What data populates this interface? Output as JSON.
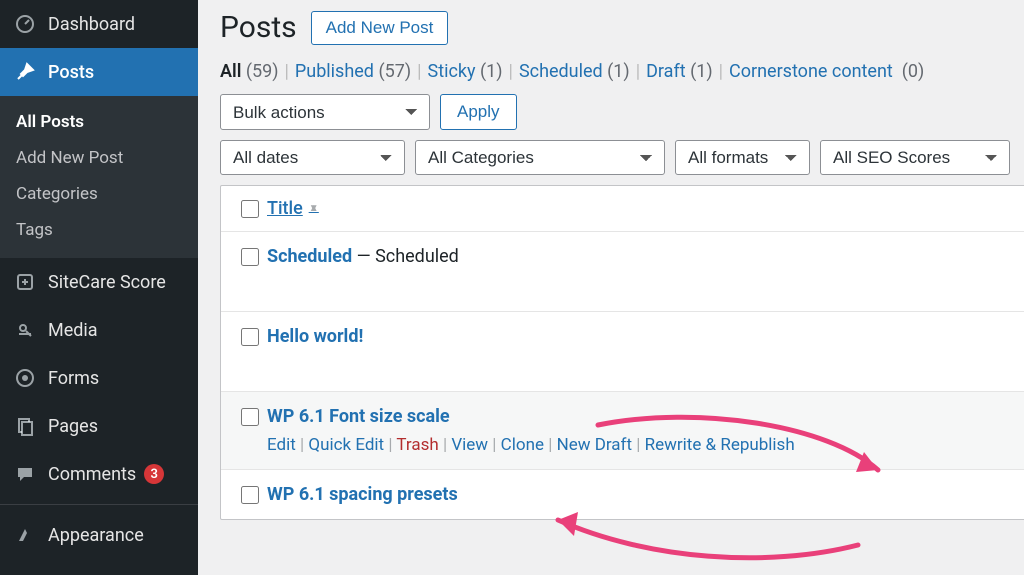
{
  "sidebar": {
    "dashboard": "Dashboard",
    "posts": "Posts",
    "submenu": {
      "all_posts": "All Posts",
      "add_new": "Add New Post",
      "categories": "Categories",
      "tags": "Tags"
    },
    "sitecare": "SiteCare Score",
    "media": "Media",
    "forms": "Forms",
    "pages": "Pages",
    "comments": "Comments",
    "comments_badge": "3",
    "appearance": "Appearance"
  },
  "header": {
    "title": "Posts",
    "add_new": "Add New Post"
  },
  "status_filters": {
    "all": "All",
    "all_count": "(59)",
    "published": "Published",
    "published_count": "(57)",
    "sticky": "Sticky",
    "sticky_count": "(1)",
    "scheduled": "Scheduled",
    "scheduled_count": "(1)",
    "draft": "Draft",
    "draft_count": "(1)",
    "cornerstone": "Cornerstone content",
    "cornerstone_count": "(0)"
  },
  "actions": {
    "bulk": "Bulk actions",
    "apply": "Apply",
    "dates": "All dates",
    "categories": "All Categories",
    "formats": "All formats",
    "seo": "All SEO Scores"
  },
  "table": {
    "col_title": "Title",
    "rows": [
      {
        "title": "Scheduled",
        "state": " — Scheduled"
      },
      {
        "title": "Hello world!"
      },
      {
        "title": "WP 6.1 Font size scale",
        "actions": {
          "edit": "Edit",
          "quick_edit": "Quick Edit",
          "trash": "Trash",
          "view": "View",
          "clone": "Clone",
          "new_draft": "New Draft",
          "rewrite": "Rewrite & Republish"
        }
      },
      {
        "title": "WP 6.1 spacing presets"
      }
    ]
  }
}
